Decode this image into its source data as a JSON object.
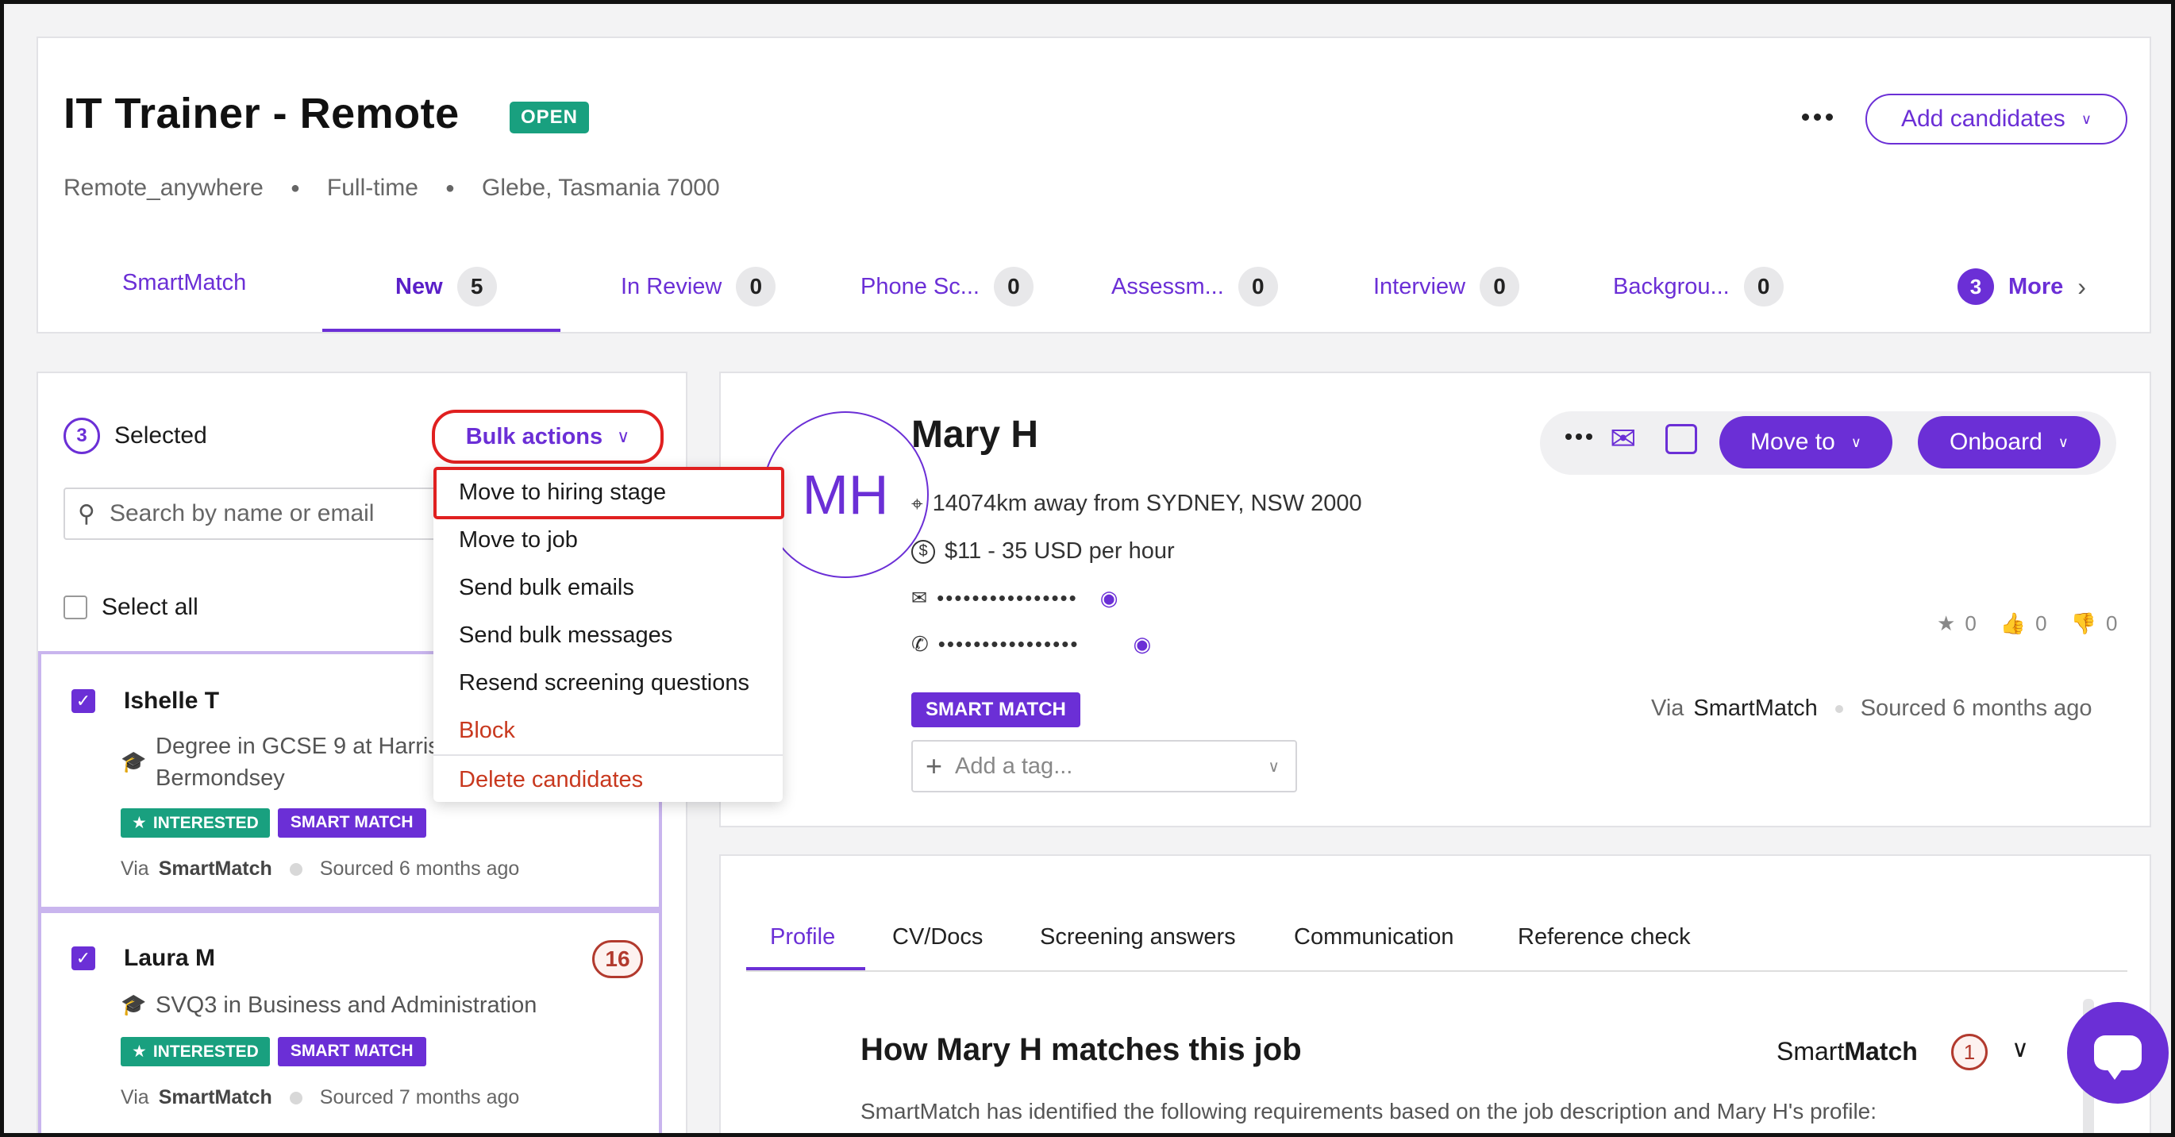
{
  "job": {
    "title": "IT Trainer - Remote",
    "status": "OPEN",
    "meta": [
      "Remote_anywhere",
      "Full-time",
      "Glebe, Tasmania 7000"
    ],
    "more_icon": "more-horizontal-icon",
    "add_candidates_label": "Add candidates"
  },
  "stage_tabs": [
    {
      "label": "SmartMatch",
      "count": null
    },
    {
      "label": "New",
      "count": "5"
    },
    {
      "label": "In Review",
      "count": "0"
    },
    {
      "label": "Phone Sc...",
      "count": "0"
    },
    {
      "label": "Assessm...",
      "count": "0"
    },
    {
      "label": "Interview",
      "count": "0"
    },
    {
      "label": "Backgrou...",
      "count": "0"
    }
  ],
  "more_tab": {
    "count": "3",
    "label": "More"
  },
  "left_panel": {
    "selected_count": "3",
    "selected_label": "Selected",
    "bulk_actions_label": "Bulk actions",
    "search_placeholder": "Search by name or email",
    "select_all_label": "Select all"
  },
  "bulk_menu": {
    "items": [
      "Move to hiring stage",
      "Move to job",
      "Send bulk emails",
      "Send bulk messages",
      "Resend screening questions",
      "Block",
      "Delete candidates"
    ]
  },
  "candidates": [
    {
      "name": "Ishelle T",
      "education": "Degree in GCSE 9 at Harris",
      "education_line2": "Bermondsey",
      "badges": [
        "INTERESTED",
        "SMART MATCH"
      ],
      "via_label": "Via",
      "via_source": "SmartMatch",
      "sourced": "Sourced 6 months ago"
    },
    {
      "name": "Laura M",
      "count": "16",
      "education": "SVQ3 in Business and Administration",
      "badges": [
        "INTERESTED",
        "SMART MATCH"
      ],
      "via_label": "Via",
      "via_source": "SmartMatch",
      "sourced": "Sourced 7 months ago"
    }
  ],
  "profile": {
    "initials": "MH",
    "name": "Mary H",
    "distance": "14074km away from SYDNEY, NSW 2000",
    "salary": "$11 - 35 USD per hour",
    "email_masked": "••••••••••••••••",
    "phone_masked": "••••••••••••••••",
    "move_to_label": "Move to",
    "onboard_label": "Onboard",
    "smart_match_badge": "SMART MATCH",
    "tag_placeholder": "Add a tag...",
    "via_label": "Via",
    "via_source": "SmartMatch",
    "sourced": "Sourced 6 months ago",
    "ratings": {
      "stars": "0",
      "thumbs_up": "0",
      "thumbs_down": "0"
    }
  },
  "profile_tabs": [
    "Profile",
    "CV/Docs",
    "Screening answers",
    "Communication",
    "Reference check"
  ],
  "match_section": {
    "title": "How Mary H matches this job",
    "brand_prefix": "Smart",
    "brand_suffix": "Match",
    "count": "1",
    "description": "SmartMatch has identified the following requirements based on the job description and Mary H's profile:"
  },
  "colors": {
    "accent": "#6b2fd6",
    "open": "#19a07f",
    "danger": "#c8381e",
    "highlight": "#e02020"
  }
}
